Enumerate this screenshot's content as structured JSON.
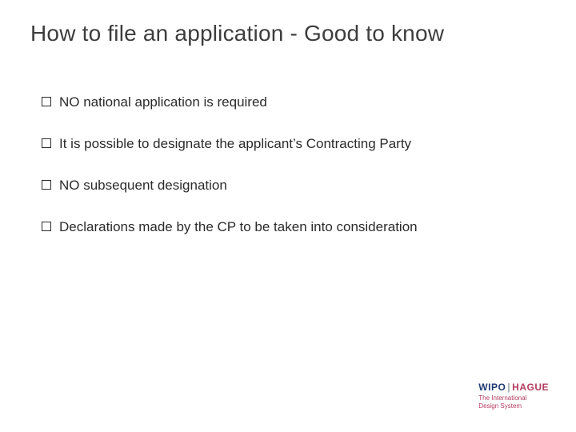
{
  "title": "How to file an application - Good to know",
  "bullets": [
    {
      "text": "NO national application is required"
    },
    {
      "text": "It is possible to designate the applicant’s Contracting Party"
    },
    {
      "text": "NO subsequent designation"
    },
    {
      "text": "Declarations made by the CP to be taken into consideration"
    }
  ],
  "logo": {
    "wipo": "WIPO",
    "separator": "|",
    "hague": "HAGUE",
    "sub1": "The International",
    "sub2": "Design System"
  }
}
